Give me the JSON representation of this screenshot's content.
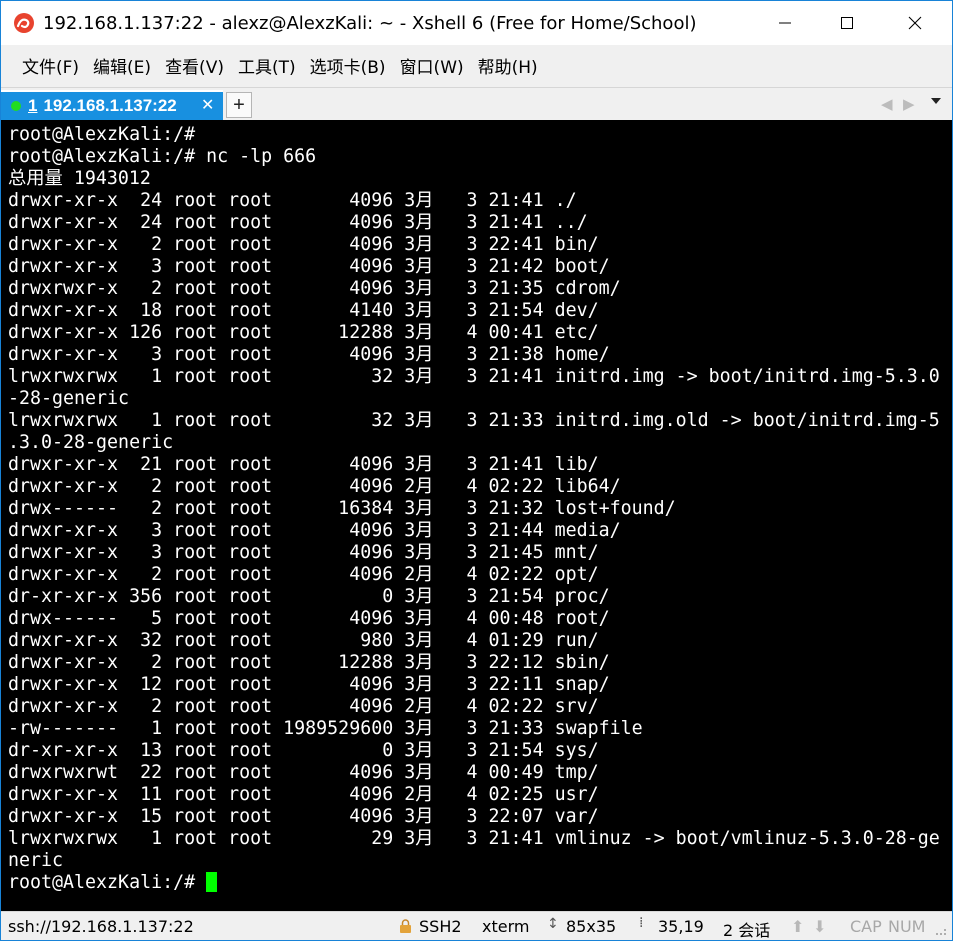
{
  "window": {
    "title": "192.168.1.137:22 - alexz@AlexzKali: ~ - Xshell 6 (Free for Home/School)",
    "accent_color": "#1890e0"
  },
  "menu": {
    "items": [
      "文件(F)",
      "编辑(E)",
      "查看(V)",
      "工具(T)",
      "选项卡(B)",
      "窗口(W)",
      "帮助(H)"
    ]
  },
  "tabs": {
    "active": {
      "number": "1",
      "label": "192.168.1.137:22",
      "status_color": "#22dd22"
    },
    "add_label": "+"
  },
  "terminal": {
    "background": "#000000",
    "foreground": "#ffffff",
    "cursor_color": "#00ff00",
    "lines": [
      "root@AlexzKali:/#",
      "root@AlexzKali:/# nc -lp 666",
      "总用量 1943012",
      "drwxr-xr-x  24 root root       4096 3月   3 21:41 ./",
      "drwxr-xr-x  24 root root       4096 3月   3 21:41 ../",
      "drwxr-xr-x   2 root root       4096 3月   3 22:41 bin/",
      "drwxr-xr-x   3 root root       4096 3月   3 21:42 boot/",
      "drwxrwxr-x   2 root root       4096 3月   3 21:35 cdrom/",
      "drwxr-xr-x  18 root root       4140 3月   3 21:54 dev/",
      "drwxr-xr-x 126 root root      12288 3月   4 00:41 etc/",
      "drwxr-xr-x   3 root root       4096 3月   3 21:38 home/",
      "lrwxrwxrwx   1 root root         32 3月   3 21:41 initrd.img -> boot/initrd.img-5.3.0",
      "-28-generic",
      "lrwxrwxrwx   1 root root         32 3月   3 21:33 initrd.img.old -> boot/initrd.img-5",
      ".3.0-28-generic",
      "drwxr-xr-x  21 root root       4096 3月   3 21:41 lib/",
      "drwxr-xr-x   2 root root       4096 2月   4 02:22 lib64/",
      "drwx------   2 root root      16384 3月   3 21:32 lost+found/",
      "drwxr-xr-x   3 root root       4096 3月   3 21:44 media/",
      "drwxr-xr-x   3 root root       4096 3月   3 21:45 mnt/",
      "drwxr-xr-x   2 root root       4096 2月   4 02:22 opt/",
      "dr-xr-xr-x 356 root root          0 3月   3 21:54 proc/",
      "drwx------   5 root root       4096 3月   4 00:48 root/",
      "drwxr-xr-x  32 root root        980 3月   4 01:29 run/",
      "drwxr-xr-x   2 root root      12288 3月   3 22:12 sbin/",
      "drwxr-xr-x  12 root root       4096 3月   3 22:11 snap/",
      "drwxr-xr-x   2 root root       4096 2月   4 02:22 srv/",
      "-rw-------   1 root root 1989529600 3月   3 21:33 swapfile",
      "dr-xr-xr-x  13 root root          0 3月   3 21:54 sys/",
      "drwxrwxrwt  22 root root       4096 3月   4 00:49 tmp/",
      "drwxr-xr-x  11 root root       4096 2月   4 02:25 usr/",
      "drwxr-xr-x  15 root root       4096 3月   3 22:07 var/",
      "lrwxrwxrwx   1 root root         29 3月   3 21:41 vmlinuz -> boot/vmlinuz-5.3.0-28-ge",
      "neric"
    ],
    "prompt": "root@AlexzKali:/# "
  },
  "statusbar": {
    "connection": "ssh://192.168.1.137:22",
    "protocol": "SSH2",
    "terminal_type": "xterm",
    "size": "85x35",
    "cursor_pos": "35,19",
    "sessions": "2 会话",
    "caps": "CAP",
    "num": "NUM"
  }
}
